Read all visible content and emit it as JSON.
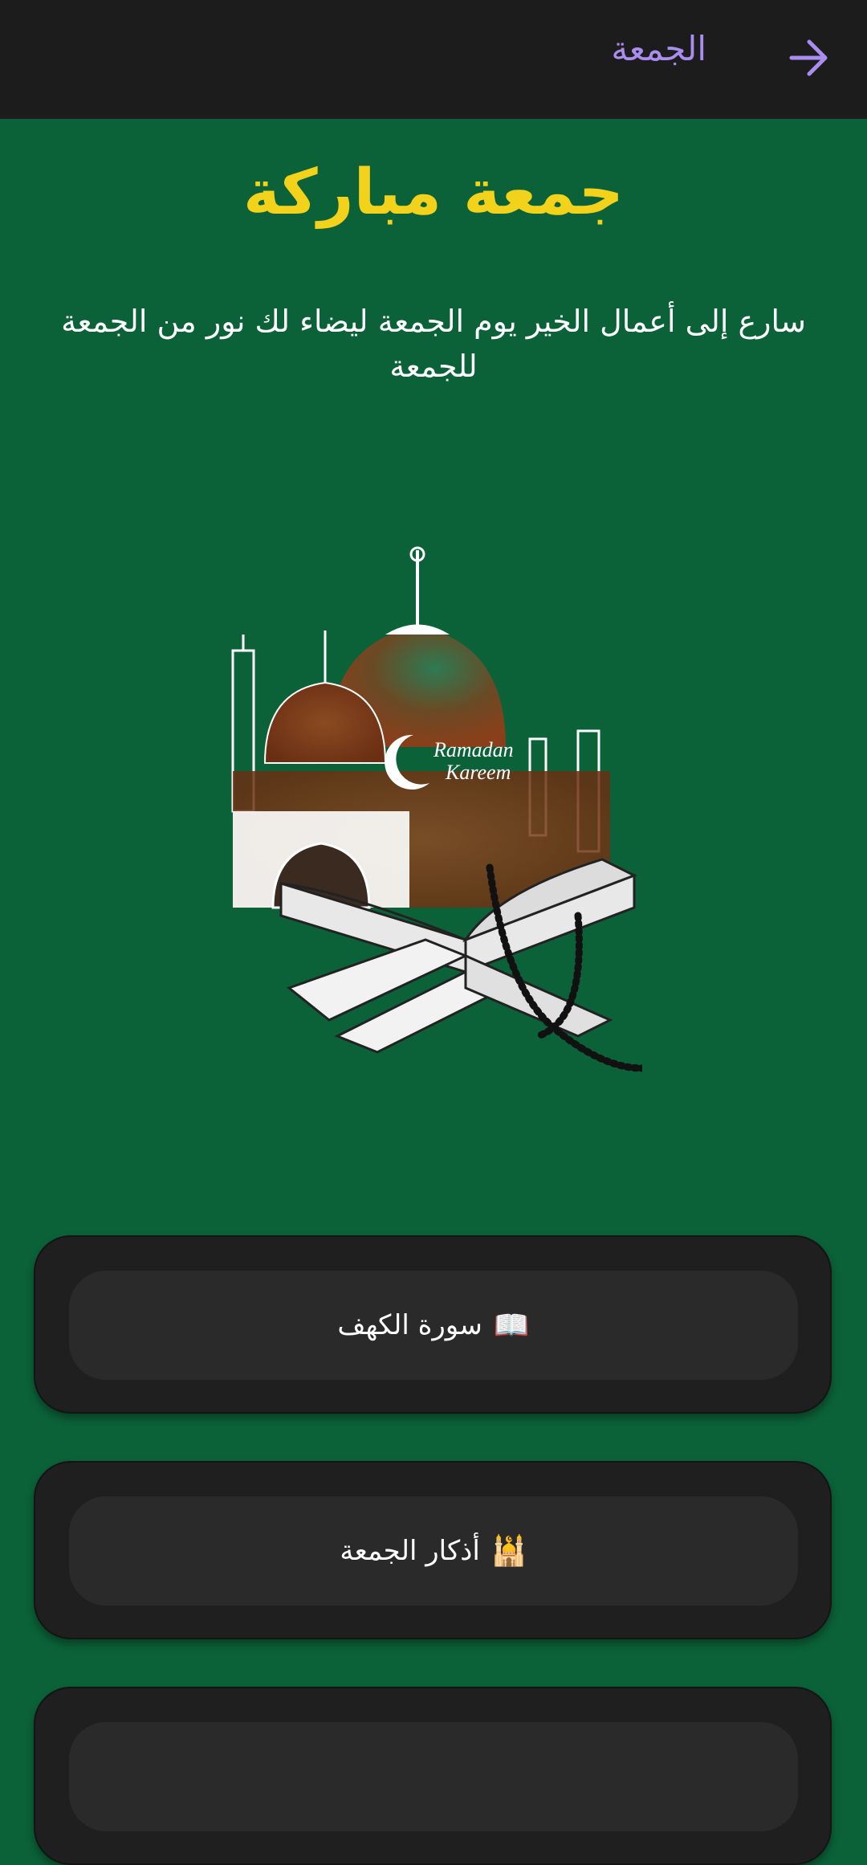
{
  "appbar": {
    "title": "الجمعة",
    "back_icon": "arrow-right-icon",
    "title_color": "#a98ef0"
  },
  "main": {
    "headline": "جمعة مباركة",
    "subtitle": "سارع إلى أعمال الخير يوم الجمعة ليضاء لك نور من الجمعة للجمعة",
    "illustration_text": "Ramadan Kareem"
  },
  "buttons": [
    {
      "emoji": "📖",
      "label": "سورة الكهف",
      "icon": "open-book-icon"
    },
    {
      "emoji": "🕌",
      "label": "أذكار الجمعة",
      "icon": "mosque-icon"
    }
  ],
  "colors": {
    "background": "#0b6238",
    "appbar": "#1c1c1c",
    "headline": "#f3d21c",
    "card": "#1f1f1f",
    "button": "#2a2a2a"
  }
}
